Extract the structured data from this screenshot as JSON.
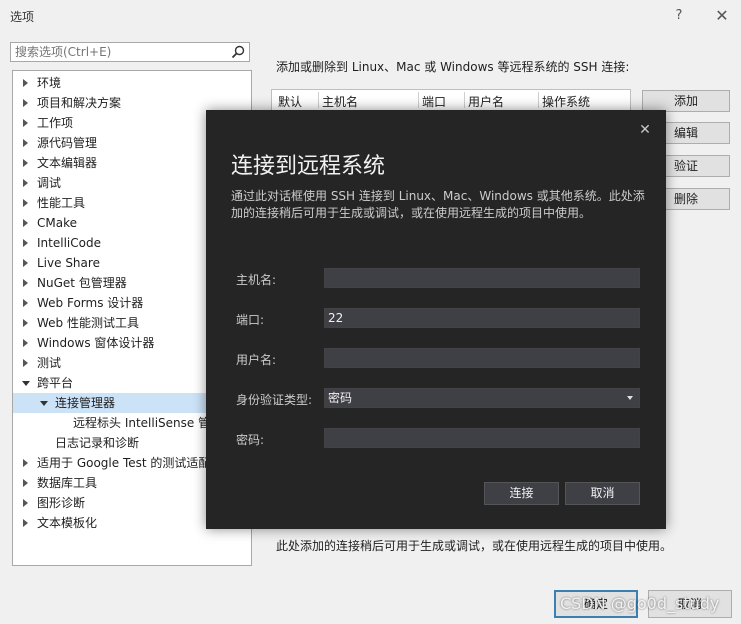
{
  "window": {
    "title": "选项",
    "help": "?",
    "close": "✕"
  },
  "search": {
    "placeholder": "搜索选项(Ctrl+E)"
  },
  "tree": {
    "items": [
      {
        "label": "环境",
        "level": 0,
        "expanded": false
      },
      {
        "label": "项目和解决方案",
        "level": 0,
        "expanded": false
      },
      {
        "label": "工作项",
        "level": 0,
        "expanded": false
      },
      {
        "label": "源代码管理",
        "level": 0,
        "expanded": false
      },
      {
        "label": "文本编辑器",
        "level": 0,
        "expanded": false
      },
      {
        "label": "调试",
        "level": 0,
        "expanded": false
      },
      {
        "label": "性能工具",
        "level": 0,
        "expanded": false
      },
      {
        "label": "CMake",
        "level": 0,
        "expanded": false
      },
      {
        "label": "IntelliCode",
        "level": 0,
        "expanded": false
      },
      {
        "label": "Live Share",
        "level": 0,
        "expanded": false
      },
      {
        "label": "NuGet 包管理器",
        "level": 0,
        "expanded": false
      },
      {
        "label": "Web Forms 设计器",
        "level": 0,
        "expanded": false
      },
      {
        "label": "Web 性能测试工具",
        "level": 0,
        "expanded": false
      },
      {
        "label": "Windows 窗体设计器",
        "level": 0,
        "expanded": false
      },
      {
        "label": "测试",
        "level": 0,
        "expanded": false
      },
      {
        "label": "跨平台",
        "level": 0,
        "expanded": true
      },
      {
        "label": "连接管理器",
        "level": 1,
        "expanded": true,
        "selected": true
      },
      {
        "label": "远程标头 IntelliSense 管",
        "level": 2
      },
      {
        "label": "日志记录和诊断",
        "level": 1
      },
      {
        "label": "适用于 Google Test 的测试适配",
        "level": 0,
        "expanded": false
      },
      {
        "label": "数据库工具",
        "level": 0,
        "expanded": false
      },
      {
        "label": "图形诊断",
        "level": 0,
        "expanded": false
      },
      {
        "label": "文本模板化",
        "level": 0,
        "expanded": false
      }
    ]
  },
  "panel": {
    "description": "添加或删除到 Linux、Mac 或 Windows 等远程系统的 SSH 连接:",
    "table_headers": [
      "默认",
      "主机名",
      "端口",
      "用户名",
      "操作系统"
    ],
    "buttons": {
      "add": "添加",
      "edit": "编辑",
      "verify": "验证",
      "delete": "删除"
    },
    "footer_note": "此处添加的连接稍后可用于生成或调试，或在使用远程生成的项目中使用。"
  },
  "footer": {
    "ok": "确定",
    "cancel": "取消"
  },
  "watermark": "CSDN @go0d_study",
  "dialog": {
    "close": "✕",
    "title": "连接到远程系统",
    "description": "通过此对话框使用 SSH 连接到 Linux、Mac、Windows 或其他系统。此处添加的连接稍后可用于生成或调试，或在使用远程生成的项目中使用。",
    "fields": {
      "host": {
        "label": "主机名:",
        "value": ""
      },
      "port": {
        "label": "端口:",
        "value": "22"
      },
      "user": {
        "label": "用户名:",
        "value": ""
      },
      "auth": {
        "label": "身份验证类型:",
        "value": "密码"
      },
      "password": {
        "label": "密码:",
        "value": ""
      }
    },
    "buttons": {
      "connect": "连接",
      "cancel": "取消"
    }
  },
  "colors": {
    "window_bg": "#f0f0f0",
    "dialog_bg": "#252526",
    "field_bg": "#3f3f46",
    "selection": "#cce2f7",
    "default_button_border": "#3c7fb1"
  }
}
